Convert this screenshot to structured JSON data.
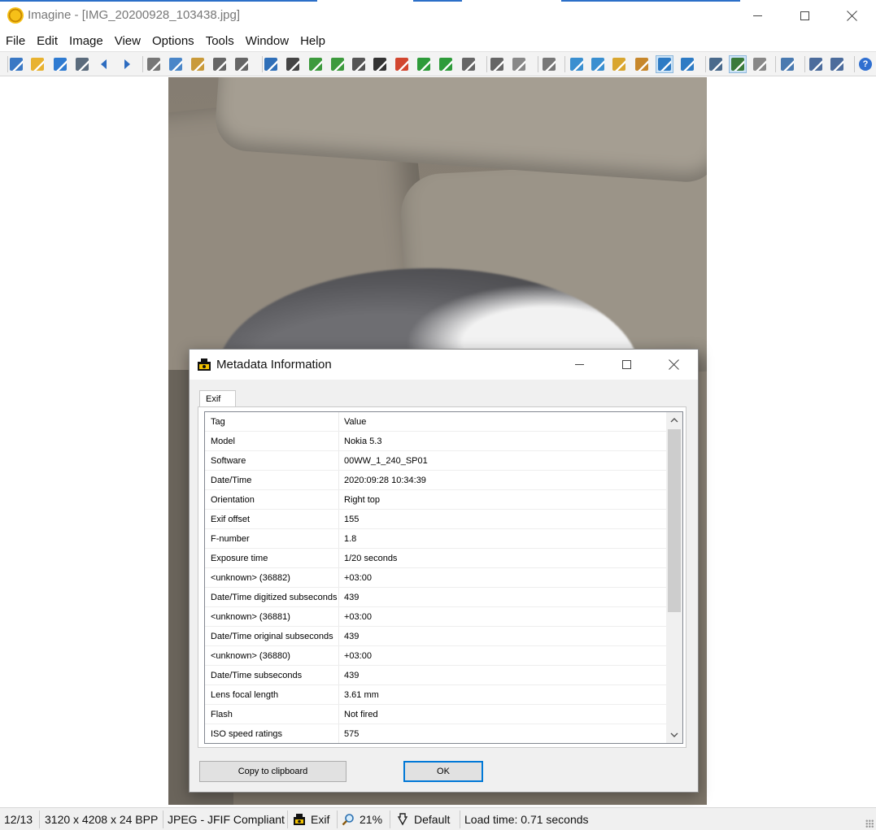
{
  "window": {
    "app_name": "Imagine",
    "title": "Imagine - [IMG_20200928_103438.jpg]"
  },
  "menu": [
    "File",
    "Edit",
    "Image",
    "View",
    "Options",
    "Tools",
    "Window",
    "Help"
  ],
  "toolbar": {
    "icons": [
      "open-icon",
      "folder-icon",
      "save-icon",
      "print-icon",
      "previous-icon",
      "next-icon",
      "cut-icon",
      "copy-icon",
      "paste-icon",
      "undo-icon",
      "redo-icon",
      "info-icon",
      "camera-icon",
      "resize-icon",
      "scan-icon",
      "grayscale-icon",
      "negative-icon",
      "palette-icon",
      "rotate-left-icon",
      "rotate-right-icon",
      "flip-icon",
      "crop-icon",
      "fit-icon",
      "refresh-icon",
      "zoom-in-icon",
      "zoom-out-icon",
      "zoom-actual-icon",
      "fit-width-icon",
      "fit-window-icon",
      "stretch-icon",
      "monitor-icon",
      "slideshow-icon",
      "wand-icon",
      "tools-icon",
      "window-icon",
      "thumbnail-icon",
      "help-icon"
    ]
  },
  "dialog": {
    "title": "Metadata Information",
    "tab": "Exif",
    "columns": {
      "tag": "Tag",
      "value": "Value"
    },
    "rows": [
      {
        "tag": "Model",
        "value": "Nokia 5.3"
      },
      {
        "tag": "Software",
        "value": "00WW_1_240_SP01"
      },
      {
        "tag": "Date/Time",
        "value": "2020:09:28 10:34:39"
      },
      {
        "tag": "Orientation",
        "value": "Right top"
      },
      {
        "tag": "Exif offset",
        "value": "155"
      },
      {
        "tag": "F-number",
        "value": "1.8"
      },
      {
        "tag": "Exposure time",
        "value": "1/20 seconds"
      },
      {
        "tag": "<unknown> (36882)",
        "value": "+03:00"
      },
      {
        "tag": "Date/Time digitized subseconds",
        "value": "439"
      },
      {
        "tag": "<unknown> (36881)",
        "value": "+03:00"
      },
      {
        "tag": "Date/Time original subseconds",
        "value": "439"
      },
      {
        "tag": "<unknown> (36880)",
        "value": "+03:00"
      },
      {
        "tag": "Date/Time subseconds",
        "value": "439"
      },
      {
        "tag": "Lens focal length",
        "value": "3.61 mm"
      },
      {
        "tag": "Flash",
        "value": "Not fired"
      },
      {
        "tag": "ISO speed ratings",
        "value": "575"
      }
    ],
    "copy_button": "Copy to clipboard",
    "ok_button": "OK"
  },
  "statusbar": {
    "index": "12/13",
    "dimensions": "3120 x 4208 x 24 BPP",
    "format": "JPEG - JFIF Compliant",
    "metadata": "Exif",
    "zoom": "21%",
    "filter": "Default",
    "load_time": "Load time: 0.71 seconds"
  },
  "colors": {
    "accent": "#0078d7",
    "title_accent": "#2b6fc8",
    "toolbar_bg": "#f3f3f3",
    "dialog_bg": "#f0f0f0"
  }
}
